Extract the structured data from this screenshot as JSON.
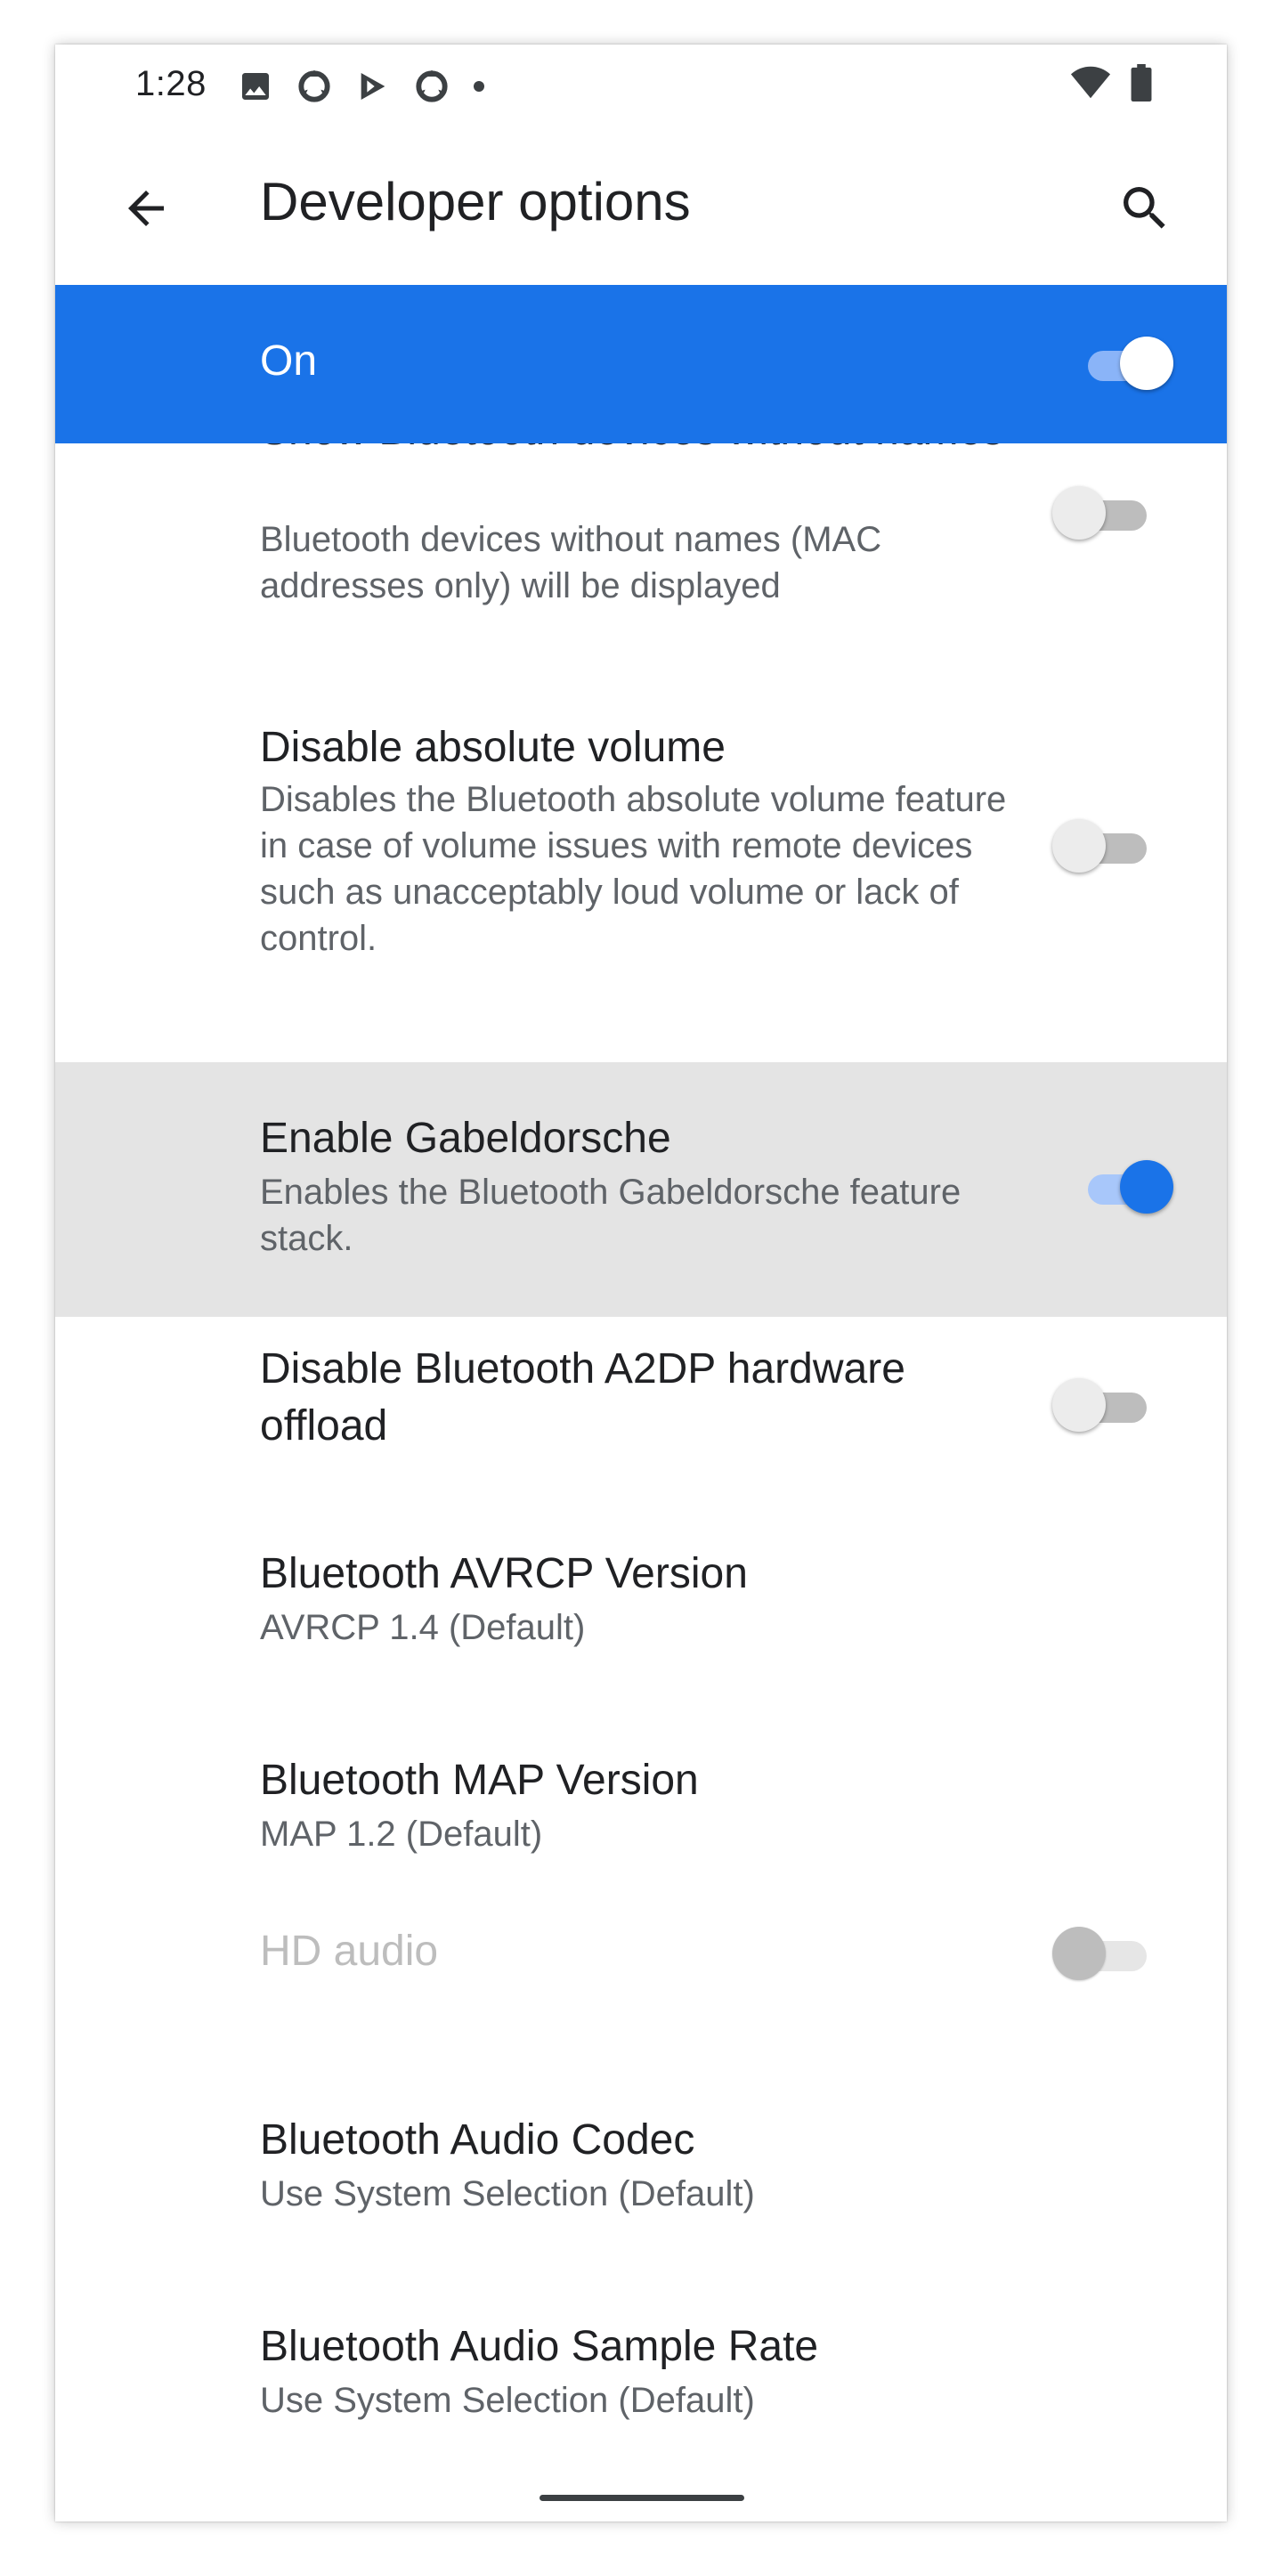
{
  "status_bar": {
    "time": "1:28",
    "icons": [
      "image-icon",
      "sync-icon",
      "play-store-icon",
      "sync-icon",
      "dot-icon"
    ],
    "right_icons": [
      "wifi-icon",
      "battery-icon"
    ]
  },
  "app_bar": {
    "title": "Developer options",
    "back_icon": "arrow-back-icon",
    "search_icon": "search-icon"
  },
  "master_switch": {
    "label": "On",
    "checked": true
  },
  "settings": [
    {
      "title": "Show Bluetooth devices without names",
      "summary": "Bluetooth devices without names (MAC addresses only) will be displayed",
      "switch": false
    },
    {
      "title": "Disable absolute volume",
      "summary": "Disables the Bluetooth absolute volume feature in case of volume issues with remote devices such as unacceptably loud volume or lack of control.",
      "switch": false
    },
    {
      "title": "Enable Gabeldorsche",
      "summary": "Enables the Bluetooth Gabeldorsche feature stack.",
      "switch": true,
      "highlighted": true
    },
    {
      "title": "Disable Bluetooth A2DP hardware offload",
      "switch": false
    },
    {
      "title": "Bluetooth AVRCP Version",
      "summary": "AVRCP 1.4 (Default)"
    },
    {
      "title": "Bluetooth MAP Version",
      "summary": "MAP 1.2 (Default)"
    },
    {
      "title": "HD audio",
      "switch": false,
      "disabled": true
    },
    {
      "title": "Bluetooth Audio Codec",
      "summary": "Use System Selection (Default)"
    },
    {
      "title": "Bluetooth Audio Sample Rate",
      "summary": "Use System Selection (Default)"
    }
  ],
  "colors": {
    "accent": "#1a73e8",
    "highlight_row": "#e4e4e4",
    "primary_text": "#202124",
    "secondary_text": "#5f6368"
  }
}
